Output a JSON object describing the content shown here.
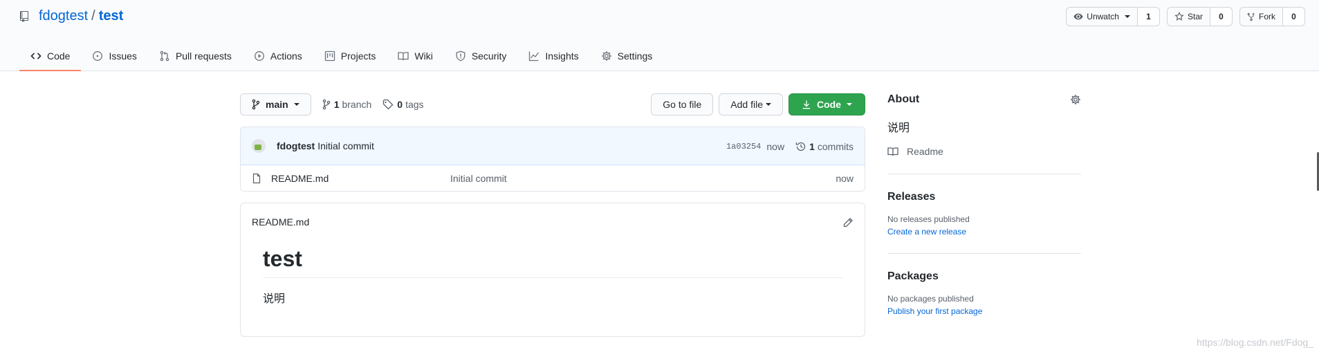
{
  "repo": {
    "owner": "fdogtest",
    "separator": "/",
    "name": "test"
  },
  "actions": {
    "watch_label": "Unwatch",
    "watch_count": "1",
    "star_label": "Star",
    "star_count": "0",
    "fork_label": "Fork",
    "fork_count": "0"
  },
  "tabs": [
    {
      "label": "Code",
      "icon": "code-icon",
      "selected": true
    },
    {
      "label": "Issues",
      "icon": "issue-opened-icon"
    },
    {
      "label": "Pull requests",
      "icon": "git-pull-request-icon"
    },
    {
      "label": "Actions",
      "icon": "play-icon"
    },
    {
      "label": "Projects",
      "icon": "project-icon"
    },
    {
      "label": "Wiki",
      "icon": "book-icon"
    },
    {
      "label": "Security",
      "icon": "shield-icon"
    },
    {
      "label": "Insights",
      "icon": "graph-icon"
    },
    {
      "label": "Settings",
      "icon": "gear-icon"
    }
  ],
  "file_nav": {
    "branch": "main",
    "branch_count": "1",
    "branch_label": "branch",
    "tag_count": "0",
    "tag_label": "tags",
    "go_to_file": "Go to file",
    "add_file": "Add file",
    "code": "Code"
  },
  "commit": {
    "author": "fdogtest",
    "message": "Initial commit",
    "sha": "1a03254",
    "age": "now",
    "commits_count": "1",
    "commits_label": "commits"
  },
  "files": [
    {
      "name": "README.md",
      "commit": "Initial commit",
      "age": "now",
      "icon": "file-icon"
    }
  ],
  "readme": {
    "filename": "README.md",
    "heading": "test",
    "body": "说明"
  },
  "sidebar": {
    "about_title": "About",
    "description": "说明",
    "readme_link": "Readme",
    "releases_title": "Releases",
    "releases_none": "No releases published",
    "releases_link": "Create a new release",
    "packages_title": "Packages",
    "packages_none": "No packages published",
    "packages_link": "Publish your first package"
  },
  "watermark": "https://blog.csdn.net/Fdog_",
  "colors": {
    "primary": "#2ea44f",
    "link": "#0366d6",
    "tab_underline": "#f9826c"
  }
}
